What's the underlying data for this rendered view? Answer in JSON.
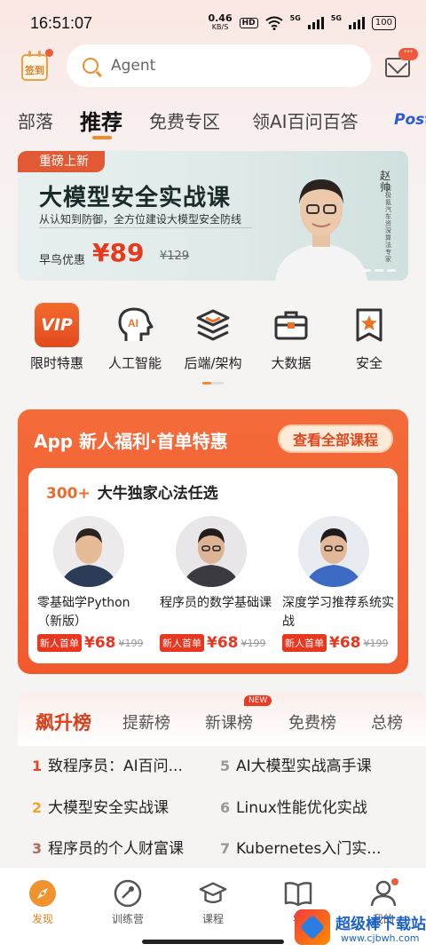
{
  "status_bar": {
    "time": "16:51:07",
    "speed": "0.46",
    "speed_unit": "KB/S",
    "hd": "HD",
    "net1": "5G",
    "net2": "5G",
    "battery": "100"
  },
  "header": {
    "signin_label": "签到",
    "search_placeholder": "Agent",
    "mail_badge": "···"
  },
  "tabs": [
    {
      "label": "部落"
    },
    {
      "label": "推荐"
    },
    {
      "label": "免费专区"
    },
    {
      "label": "领AI百问百答"
    },
    {
      "label": "Post"
    }
  ],
  "banner": {
    "tag": "重磅上新",
    "title": "大模型安全实战课",
    "subtitle": "从认知到防御，全方位建设大模型安全防线",
    "price_label": "早鸟优惠",
    "price": "¥89",
    "old_price": "¥129",
    "teacher_name": "赵帅",
    "teacher_desc": "前极氪汽车资深算法专家"
  },
  "categories": [
    {
      "label": "限时特惠",
      "icon": "vip-icon",
      "icon_text": "VIP"
    },
    {
      "label": "人工智能",
      "icon": "ai-head-icon",
      "icon_text": "AI"
    },
    {
      "label": "后端/架构",
      "icon": "layers-icon"
    },
    {
      "label": "大数据",
      "icon": "briefcase-icon"
    },
    {
      "label": "安全",
      "icon": "star-badge-icon"
    }
  ],
  "promo": {
    "title": "App 新人福利·首单特惠",
    "button": "查看全部课程",
    "card_count": "300+",
    "card_title": "大牛独家心法任选",
    "courses": [
      {
        "title": "零基础学Python（新版）",
        "tag": "新人首单",
        "price": "¥68",
        "old_price": "¥199"
      },
      {
        "title": "程序员的数学基础课",
        "tag": "新人首单",
        "price": "¥68",
        "old_price": "¥199"
      },
      {
        "title": "深度学习推荐系统实战",
        "tag": "新人首单",
        "price": "¥68",
        "old_price": "¥199"
      }
    ]
  },
  "ranking": {
    "tabs": [
      {
        "label": "飙升榜"
      },
      {
        "label": "提薪榜"
      },
      {
        "label": "新课榜"
      },
      {
        "label": "免费榜"
      },
      {
        "label": "总榜"
      }
    ],
    "new_badge": "NEW",
    "items": [
      {
        "num": "1",
        "title": "致程序员：AI百问...",
        "color": "#e0462a"
      },
      {
        "num": "2",
        "title": "大模型安全实战课",
        "color": "#f0a52a"
      },
      {
        "num": "3",
        "title": "程序员的个人财富课",
        "color": "#b06a5a"
      },
      {
        "num": "5",
        "title": "AI大模型实战高手课",
        "color": "#999999"
      },
      {
        "num": "6",
        "title": "Linux性能优化实战",
        "color": "#999999"
      },
      {
        "num": "7",
        "title": "Kubernetes入门实...",
        "color": "#999999"
      }
    ]
  },
  "bottom_nav": [
    {
      "label": "发现",
      "icon": "compass-icon"
    },
    {
      "label": "训练营",
      "icon": "training-icon"
    },
    {
      "label": "课程",
      "icon": "graduation-cap-icon"
    },
    {
      "label": "学",
      "icon": "book-icon"
    },
    {
      "label": "我的",
      "icon": "user-icon"
    }
  ],
  "watermark": {
    "text": "超级棒下载站",
    "url": "www.cjbwh.com"
  },
  "colors": {
    "accent": "#f08c2e",
    "promo": "#f15a2d",
    "price": "#e8361f"
  }
}
